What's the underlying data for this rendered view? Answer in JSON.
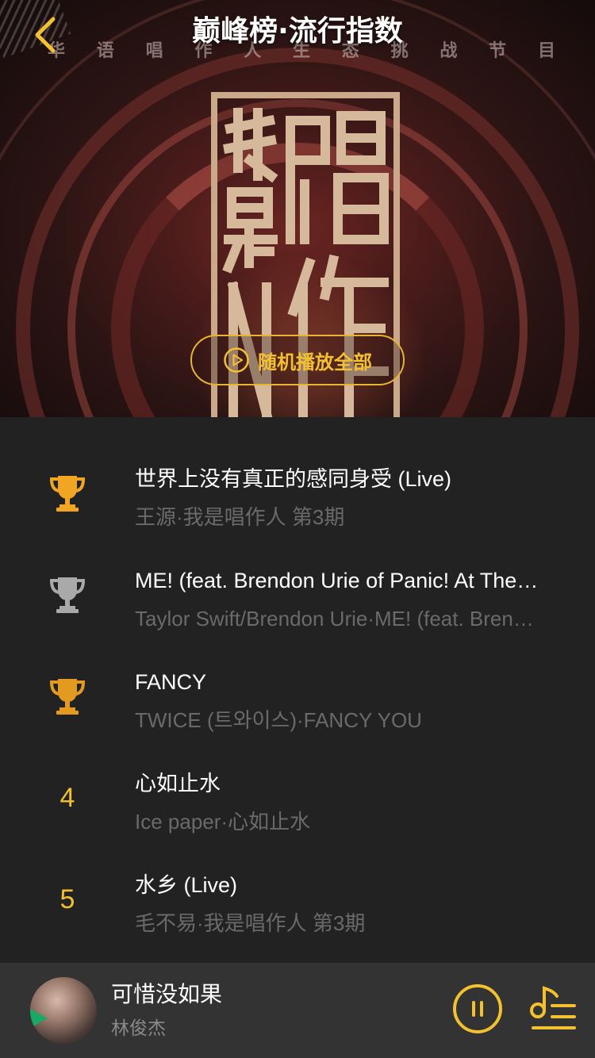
{
  "header": {
    "title": "巅峰榜·流行指数",
    "back_icon": "chevron-left-icon"
  },
  "banner": {
    "strip_chars": [
      "华",
      "语",
      "唱",
      "作",
      "人",
      "生",
      "态",
      "挑",
      "战",
      "节",
      "目"
    ],
    "logo_text": "我是唱作人",
    "play_all_label": "随机播放全部",
    "play_all_icon": "play-circle-icon"
  },
  "colors": {
    "accent": "#f3c02f",
    "gold_trophy": "#f0a623",
    "silver_trophy": "#a9a9a9",
    "background": "#222222",
    "player_bg": "#333333"
  },
  "songs": [
    {
      "rank": "1",
      "rank_type": "gold",
      "title": "世界上没有真正的感同身受 (Live)",
      "meta": "王源·我是唱作人 第3期"
    },
    {
      "rank": "2",
      "rank_type": "silver",
      "title": "ME! (feat. Brendon Urie of Panic! At The Disco)",
      "meta": "Taylor Swift/Brendon Urie·ME! (feat. Brendon Urie of Panic! At The Disco)"
    },
    {
      "rank": "3",
      "rank_type": "bronze",
      "title": "FANCY",
      "meta": "TWICE (트와이스)·FANCY YOU"
    },
    {
      "rank": "4",
      "rank_type": "number",
      "title": "心如止水",
      "meta": "Ice paper·心如止水"
    },
    {
      "rank": "5",
      "rank_type": "number",
      "title": "水乡 (Live)",
      "meta": "毛不易·我是唱作人 第3期"
    }
  ],
  "now_playing": {
    "title": "可惜没如果",
    "artist": "林俊杰",
    "pause_icon": "pause-circle-icon",
    "playlist_icon": "playlist-icon"
  }
}
